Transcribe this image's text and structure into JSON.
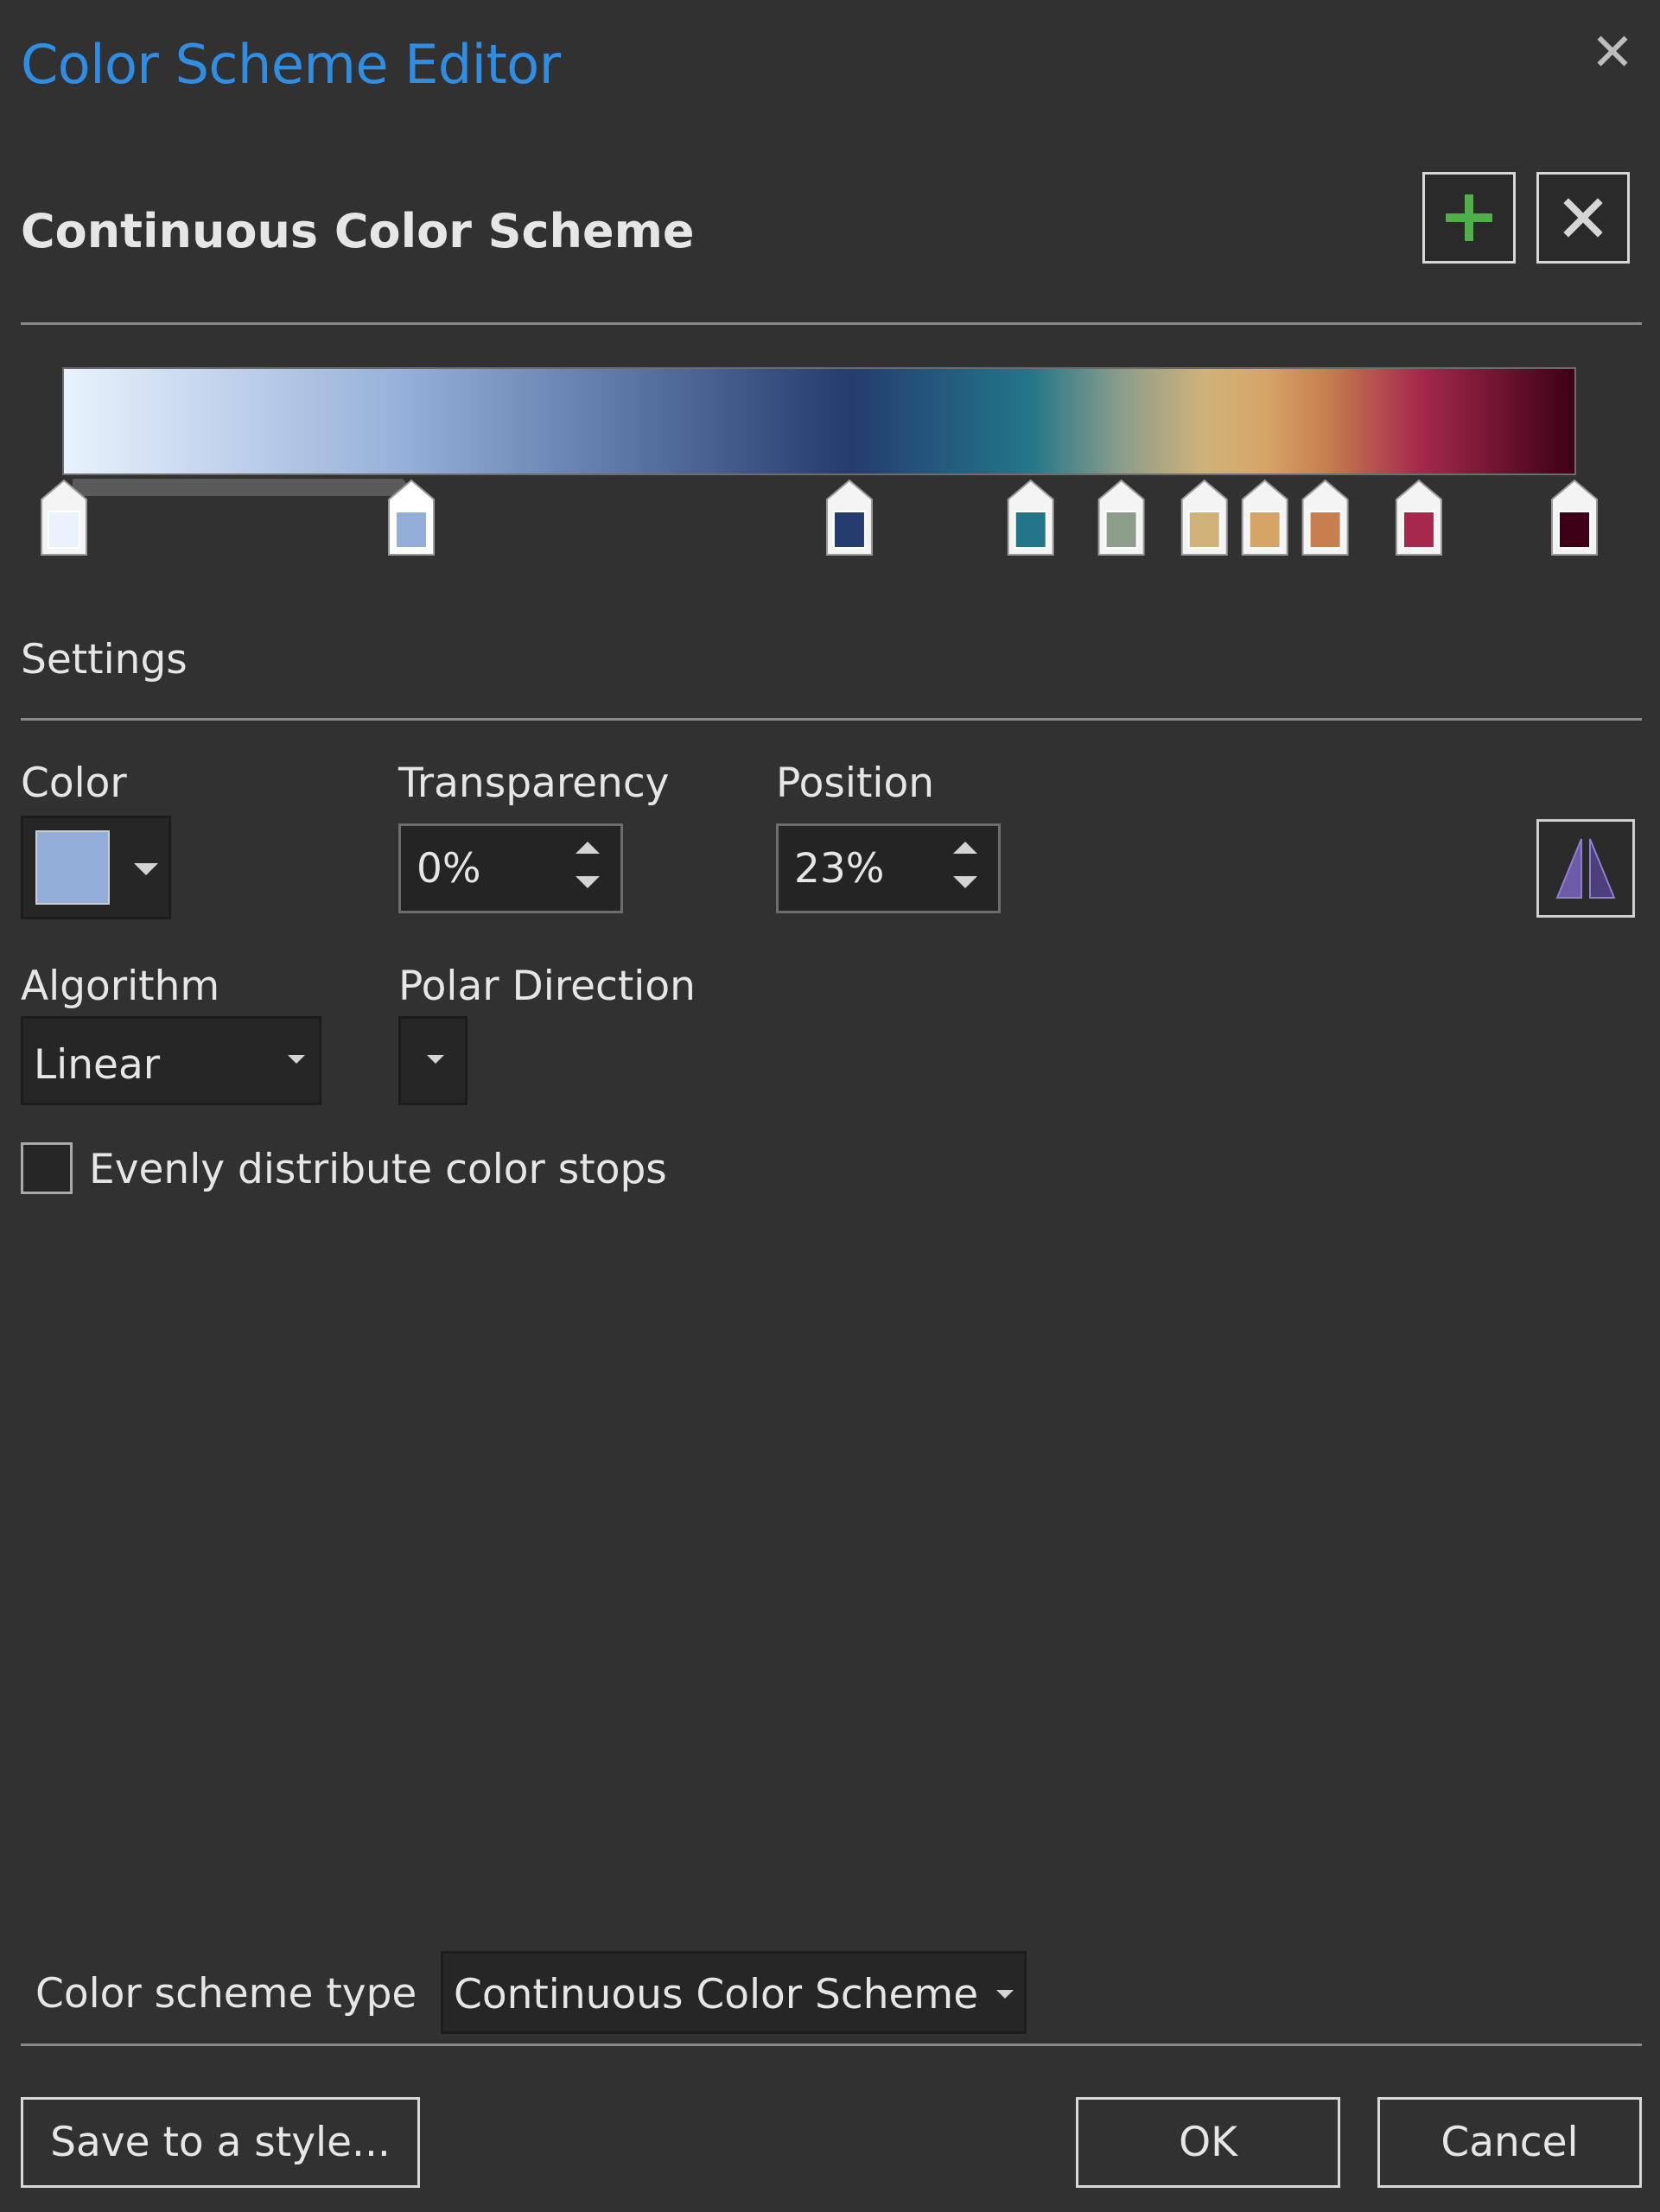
{
  "window": {
    "title": "Color Scheme Editor",
    "close_glyph": "✕"
  },
  "scheme": {
    "heading": "Continuous Color Scheme",
    "add_icon": "plus-icon",
    "delete_icon": "x-icon",
    "gradient_colors": [
      "#e9f2fd",
      "#93aed8",
      "#243c6e",
      "#23768a",
      "#8c9d8a",
      "#d0b27a",
      "#d6a566",
      "#c77f4f",
      "#a6294d",
      "#3d0016"
    ],
    "stops": [
      {
        "color": "#e9f2fd",
        "position": 0.0,
        "selected": false
      },
      {
        "color": "#93aed8",
        "position": 0.23,
        "selected": true
      },
      {
        "color": "#243c6e",
        "position": 0.52,
        "selected": false
      },
      {
        "color": "#23768a",
        "position": 0.64,
        "selected": false
      },
      {
        "color": "#8c9d8a",
        "position": 0.7,
        "selected": false
      },
      {
        "color": "#d0b27a",
        "position": 0.755,
        "selected": false
      },
      {
        "color": "#d6a566",
        "position": 0.795,
        "selected": false
      },
      {
        "color": "#c77f4f",
        "position": 0.835,
        "selected": false
      },
      {
        "color": "#a6294d",
        "position": 0.897,
        "selected": false
      },
      {
        "color": "#3d0016",
        "position": 1.0,
        "selected": false
      }
    ]
  },
  "settings": {
    "heading": "Settings",
    "color_label": "Color",
    "color_value": "#93aed8",
    "transparency_label": "Transparency",
    "transparency_value": "0%",
    "position_label": "Position",
    "position_value": "23%",
    "flip_icon": "flip-icon",
    "algorithm_label": "Algorithm",
    "algorithm_value": "Linear",
    "polar_label": "Polar Direction",
    "polar_value": "",
    "evenly_label": "Evenly distribute color stops",
    "evenly_checked": false
  },
  "footer": {
    "type_label": "Color scheme type",
    "type_value": "Continuous Color Scheme",
    "save_label": "Save to a style...",
    "ok_label": "OK",
    "cancel_label": "Cancel"
  }
}
